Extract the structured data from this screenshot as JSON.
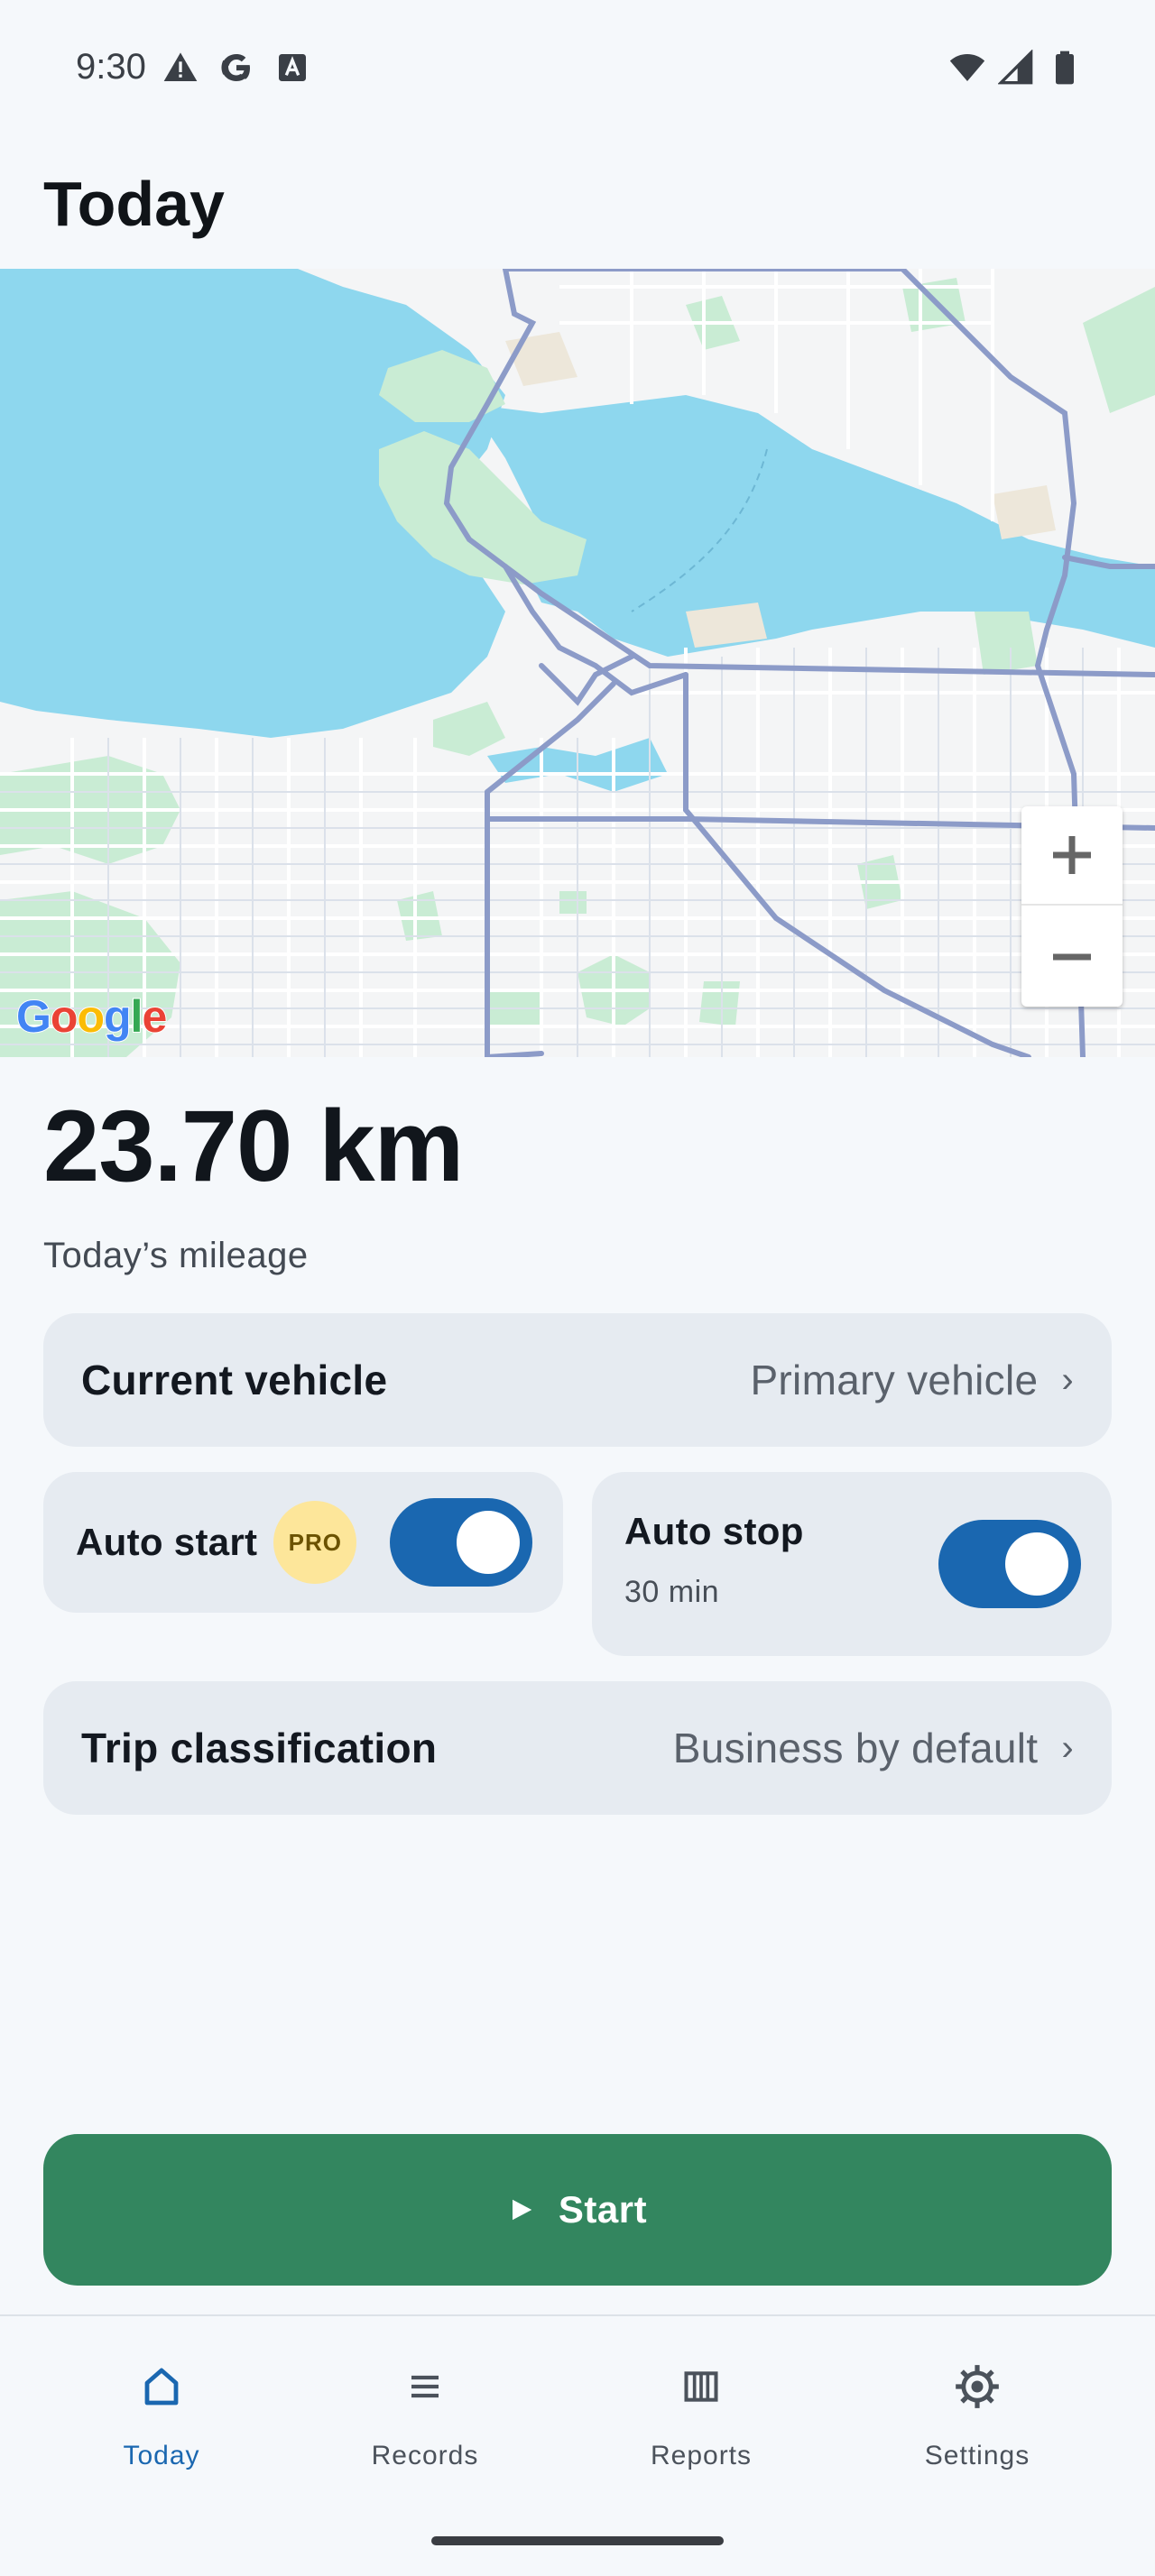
{
  "status_bar": {
    "time": "9:30",
    "left_icons": [
      "warning-icon",
      "google-icon",
      "font-icon"
    ],
    "right_icons": [
      "wifi-icon",
      "cellular-icon",
      "battery-icon"
    ]
  },
  "page": {
    "title": "Today"
  },
  "map": {
    "logo_text": "Google",
    "zoom_in_icon": "plus-icon",
    "zoom_out_icon": "minus-icon",
    "colors": {
      "water": "#8ed7ee",
      "park": "#c9ecd4",
      "land": "#f5f5f5",
      "highway": "#8c9bc8",
      "road": "#ffffff"
    }
  },
  "mileage": {
    "value": "23.70 km",
    "label": "Today’s mileage"
  },
  "vehicle": {
    "title": "Current vehicle",
    "value": "Primary vehicle",
    "chevron": "›"
  },
  "auto_start": {
    "title": "Auto start",
    "badge": "PRO",
    "enabled": true
  },
  "auto_stop": {
    "title": "Auto stop",
    "subtitle": "30 min",
    "enabled": true
  },
  "classification": {
    "title": "Trip classification",
    "value": "Business by default",
    "chevron": "›"
  },
  "start_button": {
    "icon": "play-icon",
    "label": "Start",
    "color": "#33865f"
  },
  "nav": {
    "items": [
      {
        "label": "Today",
        "icon": "home-icon",
        "active": true
      },
      {
        "label": "Records",
        "icon": "list-icon",
        "active": false
      },
      {
        "label": "Reports",
        "icon": "reports-icon",
        "active": false
      },
      {
        "label": "Settings",
        "icon": "gear-icon",
        "active": false
      }
    ]
  },
  "colors": {
    "accent": "#1a67b0",
    "card": "#e6ebf1",
    "background": "#f5f8fb"
  }
}
